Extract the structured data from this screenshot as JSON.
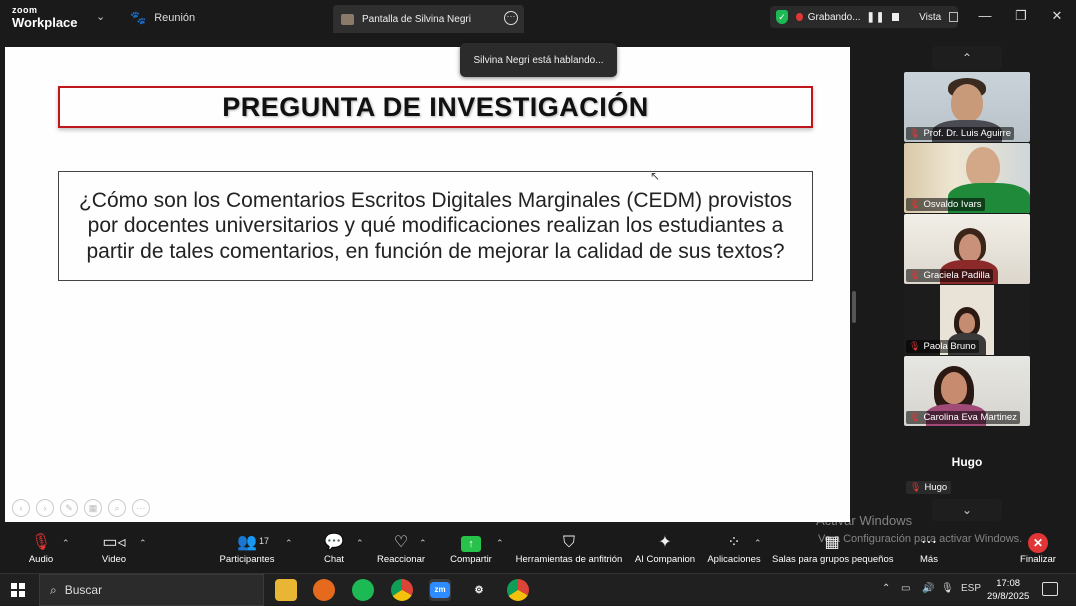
{
  "titlebar": {
    "logo_top": "zoom",
    "logo_bottom": "Workplace",
    "meeting_tab": "Reunión",
    "share_tab": "Pantalla de Silvina Negri",
    "recording": "Grabando...",
    "view": "Vista"
  },
  "tooltip": "Silvina Negri está hablando...",
  "slide": {
    "title": "PREGUNTA DE INVESTIGACIÓN",
    "question": "¿Cómo son los Comentarios Escritos Digitales Marginales (CEDM) provistos por docentes universitarios y qué modificaciones realizan los estudiantes a partir de tales comentarios, en función de mejorar la calidad de sus textos?"
  },
  "participants": [
    {
      "name": "Prof. Dr. Luis Aguirre"
    },
    {
      "name": "Osvaldo Ivars"
    },
    {
      "name": "Graciela Padilla"
    },
    {
      "name": "Paola Bruno"
    },
    {
      "name": "Carolina Eva Martinez"
    }
  ],
  "audio_only": {
    "title": "Hugo",
    "tag": "Hugo"
  },
  "watermark": {
    "line1": "Activar Windows",
    "line2": "Ve a Configuración para activar Windows."
  },
  "toolbar": {
    "audio": "Audio",
    "video": "Video",
    "participants": "Participantes",
    "participants_count": "17",
    "chat": "Chat",
    "react": "Reaccionar",
    "share": "Compartir",
    "host_tools": "Herramientas de anfitrión",
    "ai": "AI Companion",
    "apps": "Aplicaciones",
    "breakout": "Salas para grupos pequeños",
    "more": "Más",
    "end": "Finalizar"
  },
  "taskbar": {
    "search": "Buscar",
    "lang": "ESP",
    "time": "17:08",
    "date": "29/8/2025"
  },
  "colors": {
    "slide_title_border": "#c0151b",
    "share_green": "#27c24a",
    "end_red": "#e23636"
  }
}
